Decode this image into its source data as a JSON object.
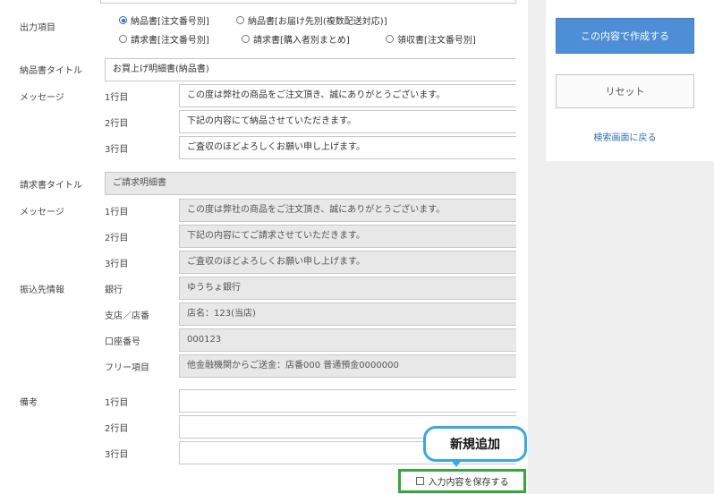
{
  "output_items": {
    "label": "出力項目",
    "options": [
      {
        "label": "納品書[注文番号別]",
        "selected": true
      },
      {
        "label": "納品書[お届け先別(複数配送対応)]",
        "selected": false
      },
      {
        "label": "請求書[注文番号別]",
        "selected": false
      },
      {
        "label": "請求書[購入者別まとめ]",
        "selected": false
      },
      {
        "label": "領収書[注文番号別]",
        "selected": false
      }
    ]
  },
  "delivery": {
    "title_label": "納品書タイトル",
    "title_value": "お買上げ明細書(納品書)",
    "message_label": "メッセージ",
    "lines": [
      {
        "label": "1行目",
        "value": "この度は弊社の商品をご注文頂き、誠にありがとうございます。"
      },
      {
        "label": "2行目",
        "value": "下記の内容にて納品させていただきます。"
      },
      {
        "label": "3行目",
        "value": "ご査収のほどよろしくお願い申し上げます。"
      }
    ]
  },
  "invoice": {
    "title_label": "請求書タイトル",
    "title_value": "ご請求明細書",
    "message_label": "メッセージ",
    "lines": [
      {
        "label": "1行目",
        "value": "この度は弊社の商品をご注文頂き、誠にありがとうございます。"
      },
      {
        "label": "2行目",
        "value": "下記の内容にてご請求させていただきます。"
      },
      {
        "label": "3行目",
        "value": "ご査収のほどよろしくお願い申し上げます。"
      }
    ]
  },
  "transfer": {
    "label": "振込先情報",
    "rows": [
      {
        "label": "銀行",
        "value": "ゆうちょ銀行"
      },
      {
        "label": "支店／店番",
        "value": "店名：123(当店)"
      },
      {
        "label": "口座番号",
        "value": "000123"
      },
      {
        "label": "フリー項目",
        "value": "他金融機関からご送金：店番000 普通預金0000000"
      }
    ]
  },
  "remarks": {
    "label": "備考",
    "lines": [
      {
        "label": "1行目",
        "value": ""
      },
      {
        "label": "2行目",
        "value": ""
      },
      {
        "label": "3行目",
        "value": ""
      }
    ]
  },
  "sidebar": {
    "create_button": "この内容で作成する",
    "reset_button": "リセット",
    "back_link": "検索画面に戻る"
  },
  "annotation": {
    "bubble_text": "新規追加",
    "save_checkbox_label": "入力内容を保存する",
    "save_checked": false
  },
  "colors": {
    "primary_button": "#4d8fd6",
    "bubble_border": "#35a9e8",
    "highlight_border": "#2faa3c",
    "link": "#2f6fb8"
  }
}
